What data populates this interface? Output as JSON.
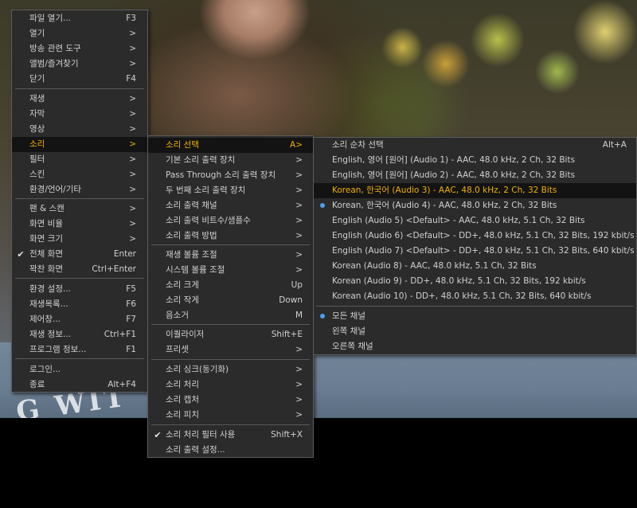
{
  "main_menu": {
    "items": [
      {
        "label": "파일 열기...",
        "shortcut": "F3"
      },
      {
        "label": "열기",
        "shortcut": ">"
      },
      {
        "label": "방송 관련 도구",
        "shortcut": ">"
      },
      {
        "label": "앨범/즐겨찾기",
        "shortcut": ">"
      },
      {
        "label": "닫기",
        "shortcut": "F4"
      },
      {
        "label": "재생",
        "shortcut": ">"
      },
      {
        "label": "자막",
        "shortcut": ">"
      },
      {
        "label": "영상",
        "shortcut": ">"
      },
      {
        "label": "소리",
        "shortcut": ">"
      },
      {
        "label": "필터",
        "shortcut": ">"
      },
      {
        "label": "스킨",
        "shortcut": ">"
      },
      {
        "label": "환경/언어/기타",
        "shortcut": ">"
      },
      {
        "label": "팬 & 스캔",
        "shortcut": ">"
      },
      {
        "label": "화면 비율",
        "shortcut": ">"
      },
      {
        "label": "화면 크기",
        "shortcut": ">"
      },
      {
        "label": "전체 화면",
        "shortcut": "Enter"
      },
      {
        "label": "꽉찬 화면",
        "shortcut": "Ctrl+Enter"
      },
      {
        "label": "환경 설정...",
        "shortcut": "F5"
      },
      {
        "label": "재생목록...",
        "shortcut": "F6"
      },
      {
        "label": "제어창...",
        "shortcut": "F7"
      },
      {
        "label": "재생 정보...",
        "shortcut": "Ctrl+F1"
      },
      {
        "label": "프로그램 정보...",
        "shortcut": "F1"
      },
      {
        "label": "로그인...",
        "shortcut": ""
      },
      {
        "label": "종료",
        "shortcut": "Alt+F4"
      }
    ]
  },
  "sound_menu": {
    "items": [
      {
        "label": "소리 선택",
        "shortcut": "A>"
      },
      {
        "label": "기본 소리 출력 장치",
        "shortcut": ">"
      },
      {
        "label": "Pass Through 소리 출력 장치",
        "shortcut": ">"
      },
      {
        "label": "두 번째 소리 출력 장치",
        "shortcut": ">"
      },
      {
        "label": "소리 출력 채널",
        "shortcut": ">"
      },
      {
        "label": "소리 출력 비트수/샘플수",
        "shortcut": ">"
      },
      {
        "label": "소리 출력 방법",
        "shortcut": ">"
      },
      {
        "label": "재생 볼륨 조절",
        "shortcut": ">"
      },
      {
        "label": "시스템 볼륨 조절",
        "shortcut": ">"
      },
      {
        "label": "소리 크게",
        "shortcut": "Up"
      },
      {
        "label": "소리 작게",
        "shortcut": "Down"
      },
      {
        "label": "음소거",
        "shortcut": "M"
      },
      {
        "label": "이퀄라이저",
        "shortcut": "Shift+E"
      },
      {
        "label": "프리셋",
        "shortcut": ">"
      },
      {
        "label": "소리 싱크(동기화)",
        "shortcut": ">"
      },
      {
        "label": "소리 처리",
        "shortcut": ">"
      },
      {
        "label": "소리 캡처",
        "shortcut": ">"
      },
      {
        "label": "소리 피치",
        "shortcut": ">"
      },
      {
        "label": "소리 처리 필터 사용",
        "shortcut": "Shift+X"
      },
      {
        "label": "소리 출력 설정...",
        "shortcut": ""
      }
    ]
  },
  "audio_select_menu": {
    "items": [
      {
        "label": "소리 순차 선택",
        "shortcut": "Alt+A"
      },
      {
        "label": "English, 영어 [원어] (Audio 1) - AAC, 48.0 kHz, 2 Ch, 32 Bits",
        "shortcut": ""
      },
      {
        "label": "English, 영어 [원어] (Audio 2) - AAC, 48.0 kHz, 2 Ch, 32 Bits",
        "shortcut": ""
      },
      {
        "label": "Korean, 한국어 (Audio 3) - AAC, 48.0 kHz, 2 Ch, 32 Bits",
        "shortcut": ""
      },
      {
        "label": "Korean, 한국어 (Audio 4) - AAC, 48.0 kHz, 2 Ch, 32 Bits",
        "shortcut": ""
      },
      {
        "label": "English (Audio 5) <Default> - AAC, 48.0 kHz, 5.1 Ch, 32 Bits",
        "shortcut": ""
      },
      {
        "label": "English (Audio 6) <Default> - DD+, 48.0 kHz, 5.1 Ch, 32 Bits, 192 kbit/s",
        "shortcut": ""
      },
      {
        "label": "English (Audio 7) <Default> - DD+, 48.0 kHz, 5.1 Ch, 32 Bits, 640 kbit/s",
        "shortcut": ""
      },
      {
        "label": "Korean (Audio 8) - AAC, 48.0 kHz, 5.1 Ch, 32 Bits",
        "shortcut": ""
      },
      {
        "label": "Korean (Audio 9) - DD+, 48.0 kHz, 5.1 Ch, 32 Bits, 192 kbit/s",
        "shortcut": ""
      },
      {
        "label": "Korean (Audio 10) - DD+, 48.0 kHz, 5.1 Ch, 32 Bits, 640 kbit/s",
        "shortcut": ""
      },
      {
        "label": "모든 채널",
        "shortcut": ""
      },
      {
        "label": "왼쪽 채널",
        "shortcut": ""
      },
      {
        "label": "오른쪽 채널",
        "shortcut": ""
      }
    ]
  },
  "video": {
    "shirt_text": "G WIT"
  },
  "icons": {
    "check": "check-icon",
    "radio": "radio-dot-icon"
  },
  "colors": {
    "menu_bg": "#2b2b2b",
    "highlight_text": "#f0b000",
    "radio_dot": "#4aa0f0"
  }
}
